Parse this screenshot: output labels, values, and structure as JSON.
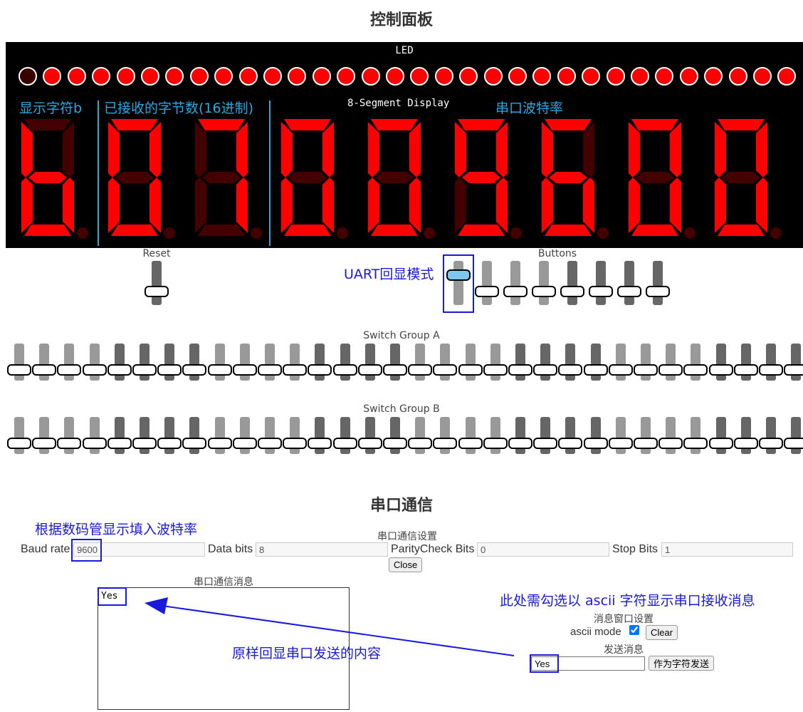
{
  "page_title": "控制面板",
  "board": {
    "led_title": "LED",
    "leds": [
      0,
      1,
      1,
      1,
      1,
      1,
      1,
      1,
      1,
      1,
      1,
      1,
      1,
      1,
      1,
      1,
      1,
      1,
      1,
      1,
      1,
      1,
      1,
      1,
      1,
      1,
      1,
      1,
      1,
      1,
      1,
      1
    ],
    "segment_title": "8-Segment Display",
    "label_char": "显示字符b",
    "label_count": "已接收的字节数(16进制)",
    "label_baud": "串口波特率",
    "digits": [
      {
        "segments": "cdefg",
        "dp": false
      },
      {
        "segments": "abcdef",
        "dp": false
      },
      {
        "segments": "abc",
        "dp": false
      },
      {
        "segments": "abcdef",
        "dp": false
      },
      {
        "segments": "abcdef",
        "dp": false
      },
      {
        "segments": "abcdfg",
        "dp": false
      },
      {
        "segments": "acdefg",
        "dp": false
      },
      {
        "segments": "abcdef",
        "dp": false
      },
      {
        "segments": "abcdef",
        "dp": false
      }
    ]
  },
  "controls": {
    "reset_label": "Reset",
    "buttons_label": "Buttons",
    "uart_echo_annotation": "UART回显模式"
  },
  "switch_group_a": {
    "label": "Switch Group A",
    "states": [
      0,
      0,
      0,
      0,
      1,
      1,
      1,
      1,
      0,
      0,
      0,
      0,
      1,
      1,
      1,
      1,
      0,
      0,
      0,
      0,
      1,
      1,
      1,
      1,
      0,
      0,
      0,
      0,
      1,
      1,
      1,
      1
    ]
  },
  "switch_group_b": {
    "label": "Switch Group B",
    "states": [
      0,
      0,
      0,
      0,
      1,
      1,
      1,
      1,
      0,
      0,
      0,
      0,
      1,
      1,
      1,
      1,
      0,
      0,
      0,
      0,
      1,
      1,
      1,
      1,
      0,
      0,
      0,
      0,
      1,
      1,
      1,
      1
    ]
  },
  "serial": {
    "title": "串口通信",
    "baud_annotation": "根据数码管显示填入波特率",
    "settings_title": "串口通信设置",
    "baud_label": "Baud rate",
    "baud_value": "9600",
    "databits_label": "Data bits",
    "databits_value": "8",
    "parity_label": "ParityCheck Bits",
    "parity_value": "0",
    "stopbits_label": "Stop Bits",
    "stopbits_value": "1",
    "close_label": "Close",
    "messages_title": "串口通信消息",
    "message_text": "Yes",
    "echo_annotation": "原样回显串口发送的内容",
    "ascii_annotation": "此处需勾选以 ascii 字符显示串口接收消息",
    "window_settings_title": "消息窗口设置",
    "ascii_mode_label": "ascii mode",
    "clear_label": "Clear",
    "send_title": "发送消息",
    "send_value": "Yes",
    "send_button_label": "作为字符发送"
  },
  "colors": {
    "led_on": "#ff0000",
    "led_off": "#3a0000",
    "segment_on": "#ff0000",
    "segment_off": "#440000",
    "label_blue": "#29a8e0",
    "annotation_blue": "#1a1adb"
  }
}
